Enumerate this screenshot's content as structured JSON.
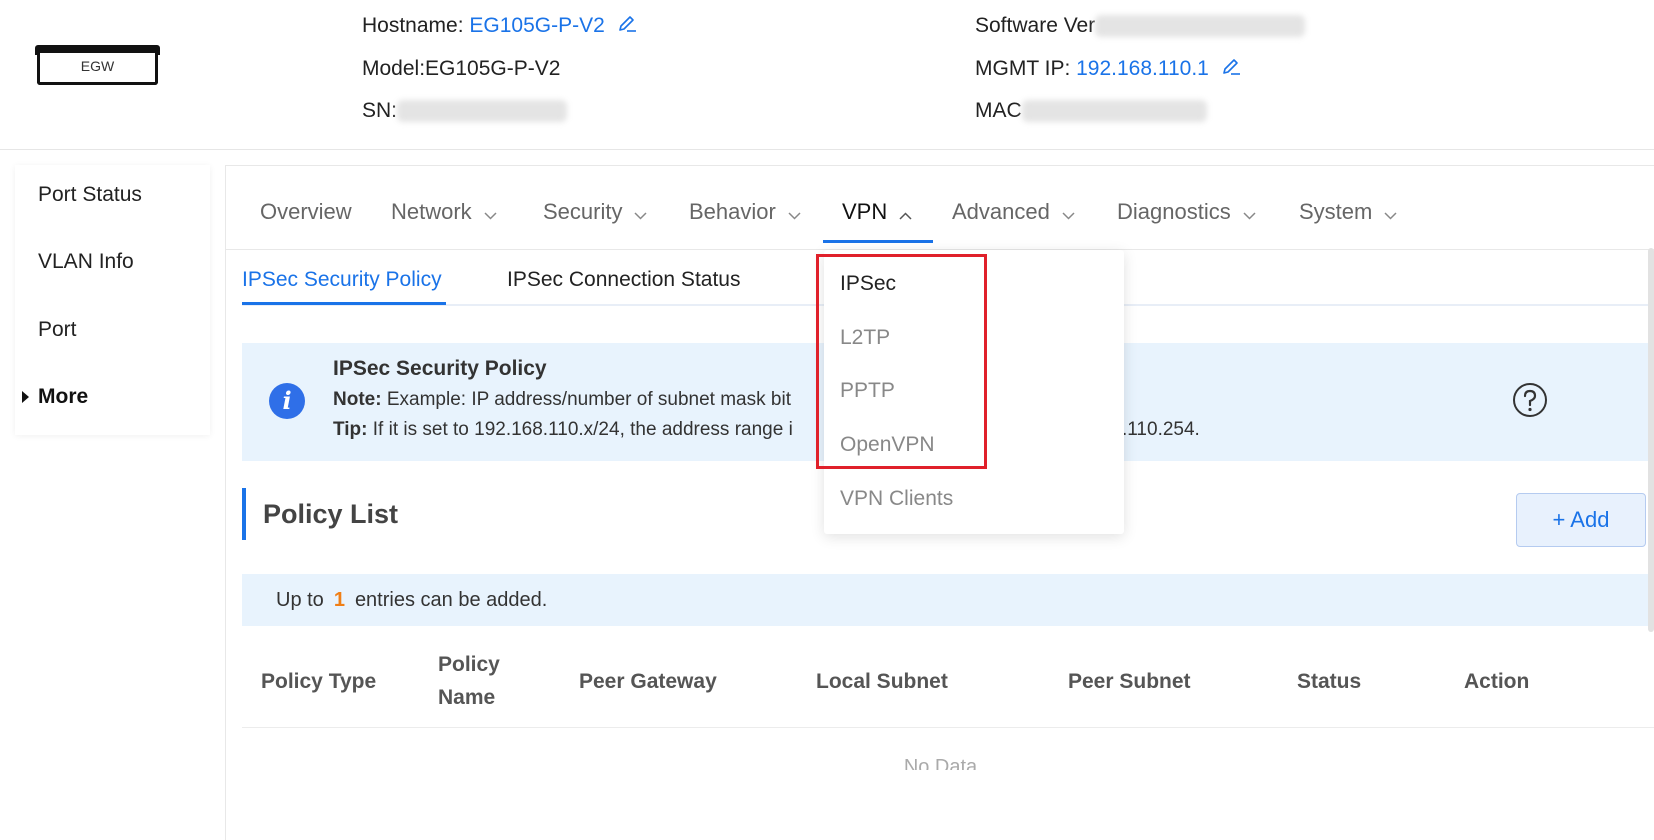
{
  "header": {
    "device_label": "EGW",
    "hostname_label": "Hostname:",
    "hostname_value": "EG105G-P-V2",
    "model_label": "Model:",
    "model_value": "EG105G-P-V2",
    "sn_label": "SN:",
    "software_label": "Software Ver",
    "mgmt_ip_label": "MGMT IP:",
    "mgmt_ip_value": "192.168.110.1",
    "mac_label": "MAC"
  },
  "sidebar": {
    "items": [
      {
        "label": "Port Status"
      },
      {
        "label": "VLAN Info"
      },
      {
        "label": "Port"
      },
      {
        "label": "More"
      }
    ]
  },
  "nav": {
    "tabs": [
      {
        "label": "Overview"
      },
      {
        "label": "Network"
      },
      {
        "label": "Security"
      },
      {
        "label": "Behavior"
      },
      {
        "label": "VPN"
      },
      {
        "label": "Advanced"
      },
      {
        "label": "Diagnostics"
      },
      {
        "label": "System"
      }
    ],
    "active": "VPN"
  },
  "vpn_menu": {
    "items": [
      {
        "label": "IPSec"
      },
      {
        "label": "L2TP"
      },
      {
        "label": "PPTP"
      },
      {
        "label": "OpenVPN"
      },
      {
        "label": "VPN Clients"
      }
    ],
    "active": "IPSec"
  },
  "subtabs": {
    "items": [
      {
        "label": "IPSec Security Policy"
      },
      {
        "label": "IPSec Connection Status"
      }
    ],
    "active": "IPSec Security Policy"
  },
  "notice": {
    "title": "IPSec Security Policy",
    "note_label": "Note:",
    "note_text": "Example: IP address/number of subnet mask bit",
    "tip_label": "Tip:",
    "tip_text_a": "If it is set to 192.168.110.x/24, the address range i",
    "tip_text_b": ".110.254."
  },
  "policy": {
    "title": "Policy List",
    "add_label": "+ Add",
    "limit_prefix": "Up to",
    "limit_count": "1",
    "limit_suffix": "entries can be added."
  },
  "table": {
    "headers": [
      {
        "label": "Policy Type"
      },
      {
        "label_line1": "Policy",
        "label_line2": "Name"
      },
      {
        "label": "Peer Gateway"
      },
      {
        "label": "Local Subnet"
      },
      {
        "label": "Peer Subnet"
      },
      {
        "label": "Status"
      },
      {
        "label": "Action"
      }
    ],
    "empty_text": "No Data"
  },
  "colors": {
    "accent": "#1a73e8",
    "highlight": "#e0202a",
    "count": "#f07f16",
    "notice_bg": "#e8f3fd"
  }
}
